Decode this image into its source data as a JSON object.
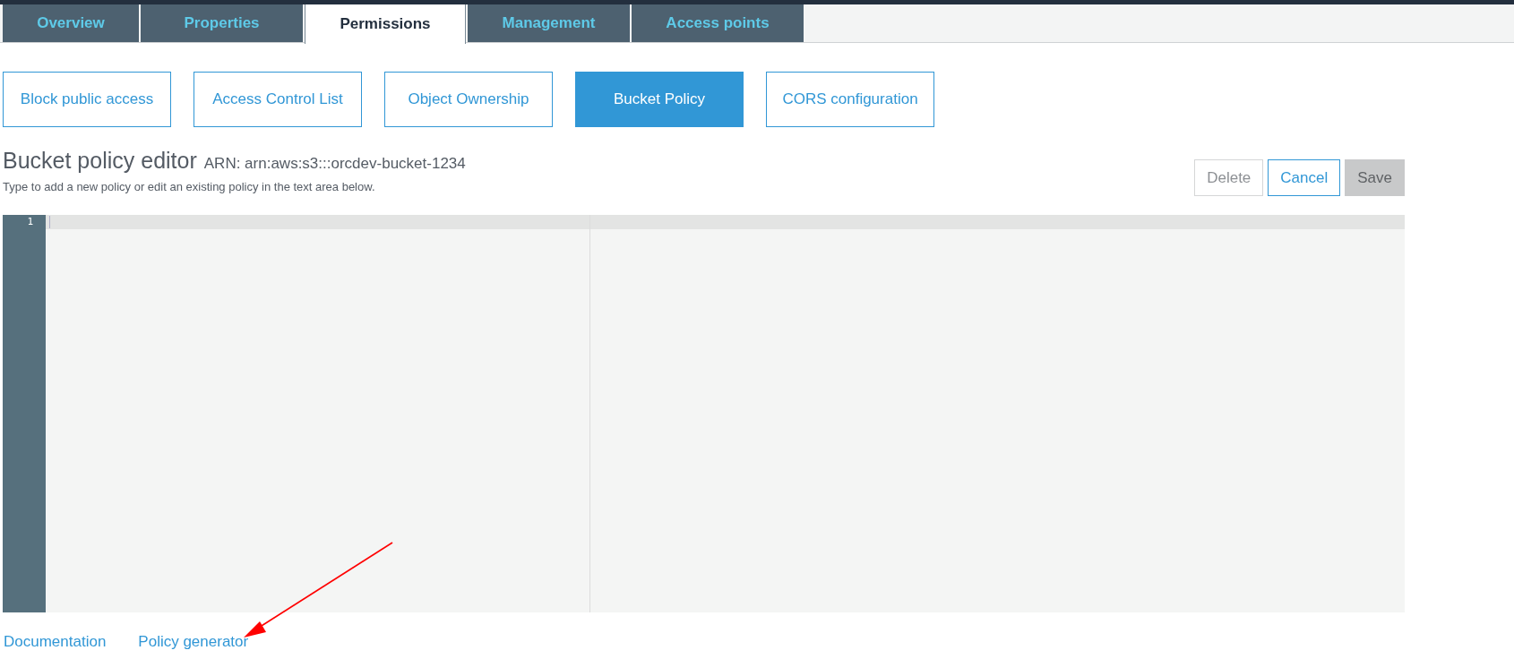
{
  "tabs": [
    {
      "label": "Overview",
      "selected": false
    },
    {
      "label": "Properties",
      "selected": false
    },
    {
      "label": "Permissions",
      "selected": true
    },
    {
      "label": "Management",
      "selected": false
    },
    {
      "label": "Access points",
      "selected": false
    }
  ],
  "subtabs": [
    {
      "label": "Block public access",
      "selected": false
    },
    {
      "label": "Access Control List",
      "selected": false
    },
    {
      "label": "Object Ownership",
      "selected": false
    },
    {
      "label": "Bucket Policy",
      "selected": true
    },
    {
      "label": "CORS configuration",
      "selected": false
    }
  ],
  "editor": {
    "title": "Bucket policy editor",
    "arn": "ARN: arn:aws:s3:::orcdev-bucket-1234",
    "hint": "Type to add a new policy or edit an existing policy in the text area below.",
    "buttons": [
      {
        "label": "Delete",
        "kind": "secondary",
        "disabled": true
      },
      {
        "label": "Cancel",
        "kind": "secondary",
        "disabled": false
      },
      {
        "label": "Save",
        "kind": "primary",
        "disabled": true
      }
    ],
    "line_numbers": [
      "1"
    ]
  },
  "links": [
    "Documentation",
    "Policy generator"
  ]
}
